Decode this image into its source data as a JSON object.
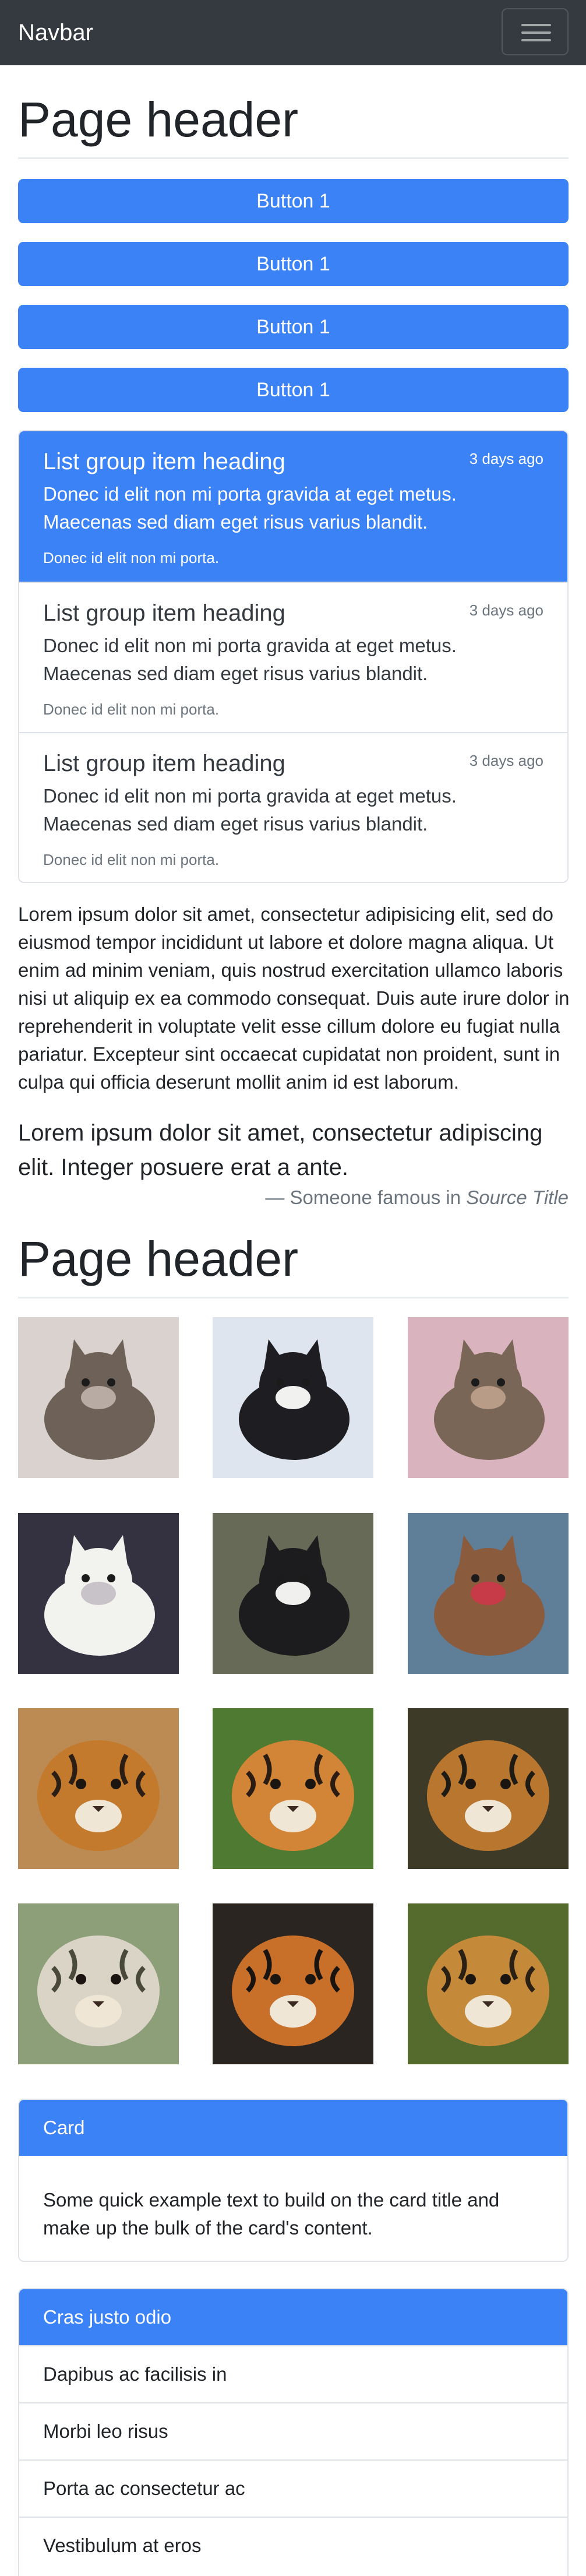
{
  "navbar": {
    "brand": "Navbar",
    "toggler_icon": "hamburger-menu-icon"
  },
  "header1": {
    "title": "Page header"
  },
  "buttons": [
    {
      "label": "Button 1"
    },
    {
      "label": "Button 1"
    },
    {
      "label": "Button 1"
    },
    {
      "label": "Button 1"
    }
  ],
  "list_group": [
    {
      "heading": "List group item heading",
      "time": "3 days ago",
      "text": "Donec id elit non mi porta gravida at eget metus. Maecenas sed diam eget risus varius blandit.",
      "small": "Donec id elit non mi porta.",
      "active": true
    },
    {
      "heading": "List group item heading",
      "time": "3 days ago",
      "text": "Donec id elit non mi porta gravida at eget metus. Maecenas sed diam eget risus varius blandit.",
      "small": "Donec id elit non mi porta.",
      "active": false
    },
    {
      "heading": "List group item heading",
      "time": "3 days ago",
      "text": "Donec id elit non mi porta gravida at eget metus. Maecenas sed diam eget risus varius blandit.",
      "small": "Donec id elit non mi porta.",
      "active": false
    }
  ],
  "paragraph": "Lorem ipsum dolor sit amet, consectetur adipisicing elit, sed do eiusmod tempor incididunt ut labore et dolore magna aliqua. Ut enim ad minim veniam, quis nostrud exercitation ullamco laboris nisi ut aliquip ex ea commodo consequat. Duis aute irure dolor in reprehenderit in voluptate velit esse cillum dolore eu fugiat nulla pariatur. Excepteur sint occaecat cupidatat non proident, sunt in culpa qui officia deserunt mollit anim id est laborum.",
  "blockquote": {
    "text": "Lorem ipsum dolor sit amet, consectetur adipiscing elit. Integer posuere erat a ante.",
    "footer_prefix": "— Someone famous in",
    "source": "Source Title"
  },
  "header2": {
    "title": "Page header"
  },
  "gallery": [
    {
      "subject": "cat",
      "bg": "#d9d2cf",
      "body": "#6e6157",
      "accent": "#b8aba4"
    },
    {
      "subject": "cat",
      "bg": "#dfe5ee",
      "body": "#1e1e22",
      "accent": "#f1f1ef"
    },
    {
      "subject": "cat",
      "bg": "#d9b3bd",
      "body": "#7a6656",
      "accent": "#b89c87"
    },
    {
      "subject": "cat",
      "bg": "#343240",
      "body": "#f2f2ef",
      "accent": "#c8c3c8"
    },
    {
      "subject": "cat",
      "bg": "#686a58",
      "body": "#1c1c1e",
      "accent": "#f0f0ee"
    },
    {
      "subject": "cat",
      "bg": "#5f7e97",
      "body": "#8a5b3d",
      "accent": "#c63b47"
    },
    {
      "subject": "tiger",
      "bg": "#bc8b53",
      "body": "#c47a2d",
      "accent": "#2b1e14"
    },
    {
      "subject": "tiger",
      "bg": "#4f7a31",
      "body": "#d28536",
      "accent": "#2a1c12"
    },
    {
      "subject": "tiger",
      "bg": "#3d3a28",
      "body": "#b9762f",
      "accent": "#1e1a14"
    },
    {
      "subject": "tiger",
      "bg": "#8c9f79",
      "body": "#d9d4c6",
      "accent": "#4a4a3c"
    },
    {
      "subject": "tiger",
      "bg": "#2a2520",
      "body": "#c86f2a",
      "accent": "#1a1410"
    },
    {
      "subject": "tiger",
      "bg": "#556b2e",
      "body": "#c48a3a",
      "accent": "#2b2014"
    }
  ],
  "card": {
    "header": "Card",
    "text": "Some quick example text to build on the card title and make up the bulk of the card's content."
  },
  "panel": {
    "header": "Cras justo odio",
    "items": [
      "Dapibus ac facilisis in",
      "Morbi leo risus",
      "Porta ac consectetur ac",
      "Vestibulum at eros"
    ]
  }
}
